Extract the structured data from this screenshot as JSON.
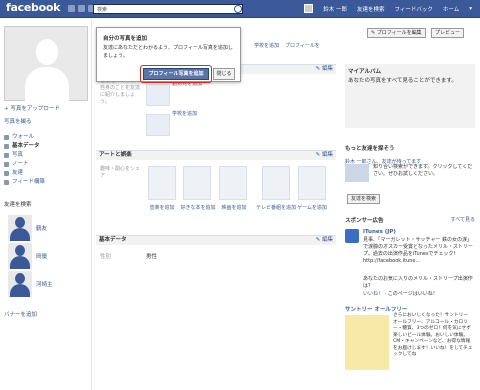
{
  "header": {
    "logo": "facebook",
    "search_placeholder": "検索",
    "user": "鈴木 一郎",
    "nav": [
      "友達を検索",
      "フィードバック",
      "ホーム"
    ]
  },
  "left": {
    "upload_photo": "+ 写真をアップロード",
    "take_photo": "写真を撮る",
    "nav": [
      {
        "label": "ウォール",
        "selected": false
      },
      {
        "label": "基本データ",
        "selected": true
      },
      {
        "label": "写真",
        "selected": false
      },
      {
        "label": "ノート",
        "selected": false
      },
      {
        "label": "友達",
        "selected": false
      },
      {
        "label": "フィード構築",
        "selected": false
      }
    ],
    "friends_header": "友達を検索",
    "friends": [
      "鶴友",
      "岡優",
      "河崎主"
    ],
    "add_banner": "バナーを追加"
  },
  "popup": {
    "title": "自分の写真を追加",
    "desc": "友達にあなただとわかるよう、プロフィール写真を追加しましょう。",
    "primary": "プロフィール写真を追加",
    "close": "閉じる"
  },
  "main": {
    "top_links": [
      "学校を追加",
      "プロフィールを"
    ],
    "edit": "✎ 編集",
    "bio_text": "自己紹介：あなた自身のことを友達に紹介しましょう。",
    "work_label": "勤務先を追加",
    "school_label": "学校を追加",
    "arts_title": "アートと娯楽",
    "arts_left": "趣味・関心をシェア",
    "arts": [
      "音楽を追加",
      "好きな本を追加",
      "映画を追加",
      "テレビ番組を追加",
      "ゲームを追加"
    ],
    "basic_title": "基本データ",
    "gender_k": "性別",
    "gender_v": "男性"
  },
  "right": {
    "edit_profile": "✎ プロフィールを編集",
    "preview": "プレビュー",
    "album_title": "マイアルバム",
    "album_text": "あなたの写真をすべて見ることができます。",
    "find_title": "もっと友達を探そう",
    "find_line": "鈴木 一郎さん、友達が待ってます",
    "find_desc": "知り合い検索ができます。クリックしてください。ぜひお試しください。",
    "find_btn": "友達を検索",
    "sponsor": "スポンサー広告",
    "see_all": "すべて見る",
    "ad1_title": "iTunes (JP)",
    "ad1_text": "見事、「マーガレット・サッチャー 鉄の女の涙」で涙腺のオスカー受賞となったメリル・ストリープ。過去の出演作品をiTunesでチェック！ http://facebook.itune...",
    "ad1_link": "あなたのお気に入りのメリル・ストリープ出演作は？",
    "ad1_like": "いいね！",
    "ad1_like_meta": "このページはいいね！",
    "ad2_title": "サントリー オールフリー",
    "ad2_text": "さらにおいしくなった！サントリー オールフリー、アルコール・カロリー・糖質、3つのゼロ！何を気にせず楽しいビール体験。おいしい体験。CM・キャンペーンなど、お得な情報をお届けします！いいね！をしてチェックしてね"
  }
}
